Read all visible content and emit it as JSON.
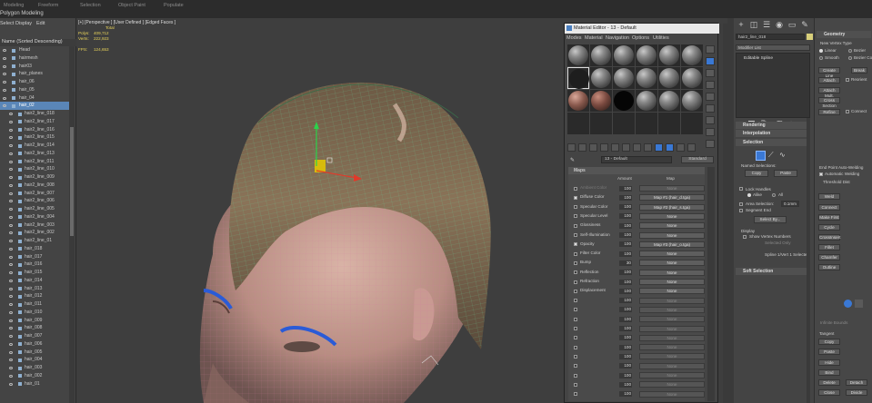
{
  "ribbon": {
    "tabs": [
      "Modeling",
      "Freeform",
      "Selection",
      "Object Paint",
      "Populate"
    ],
    "subtitle": "Polygon Modeling"
  },
  "explorer": {
    "menu": [
      "Select",
      "Display",
      "Edit"
    ],
    "header": "Name (Sorted Descending)",
    "rows": [
      {
        "label": "Head",
        "level": 0,
        "selected": false
      },
      {
        "label": "hairmesh",
        "level": 0,
        "selected": false
      },
      {
        "label": "hair03",
        "level": 0,
        "selected": false
      },
      {
        "label": "hair_planes",
        "level": 0,
        "selected": false
      },
      {
        "label": "hair_06",
        "level": 0,
        "selected": false
      },
      {
        "label": "hair_05",
        "level": 0,
        "selected": false
      },
      {
        "label": "hair_04",
        "level": 0,
        "selected": false
      },
      {
        "label": "hair_02",
        "level": 0,
        "selected": true
      },
      {
        "label": "hair2_line_018",
        "level": 1,
        "selected": false
      },
      {
        "label": "hair2_line_017",
        "level": 1,
        "selected": false
      },
      {
        "label": "hair2_line_016",
        "level": 1,
        "selected": false
      },
      {
        "label": "hair2_line_015",
        "level": 1,
        "selected": false
      },
      {
        "label": "hair2_line_014",
        "level": 1,
        "selected": false
      },
      {
        "label": "hair2_line_013",
        "level": 1,
        "selected": false
      },
      {
        "label": "hair2_line_011",
        "level": 1,
        "selected": false
      },
      {
        "label": "hair2_line_010",
        "level": 1,
        "selected": false
      },
      {
        "label": "hair2_line_009",
        "level": 1,
        "selected": false
      },
      {
        "label": "hair2_line_008",
        "level": 1,
        "selected": false
      },
      {
        "label": "hair2_line_007",
        "level": 1,
        "selected": false
      },
      {
        "label": "hair2_line_006",
        "level": 1,
        "selected": false
      },
      {
        "label": "hair2_line_005",
        "level": 1,
        "selected": false
      },
      {
        "label": "hair2_line_004",
        "level": 1,
        "selected": false
      },
      {
        "label": "hair2_line_003",
        "level": 1,
        "selected": false
      },
      {
        "label": "hair2_line_002",
        "level": 1,
        "selected": false
      },
      {
        "label": "hair2_line_01",
        "level": 1,
        "selected": false
      },
      {
        "label": "hair_018",
        "level": 1,
        "selected": false
      },
      {
        "label": "hair_017",
        "level": 1,
        "selected": false
      },
      {
        "label": "hair_016",
        "level": 1,
        "selected": false
      },
      {
        "label": "hair_015",
        "level": 1,
        "selected": false
      },
      {
        "label": "hair_014",
        "level": 1,
        "selected": false
      },
      {
        "label": "hair_013",
        "level": 1,
        "selected": false
      },
      {
        "label": "hair_012",
        "level": 1,
        "selected": false
      },
      {
        "label": "hair_011",
        "level": 1,
        "selected": false
      },
      {
        "label": "hair_010",
        "level": 1,
        "selected": false
      },
      {
        "label": "hair_009",
        "level": 1,
        "selected": false
      },
      {
        "label": "hair_008",
        "level": 1,
        "selected": false
      },
      {
        "label": "hair_007",
        "level": 1,
        "selected": false
      },
      {
        "label": "hair_006",
        "level": 1,
        "selected": false
      },
      {
        "label": "hair_005",
        "level": 1,
        "selected": false
      },
      {
        "label": "hair_004",
        "level": 1,
        "selected": false
      },
      {
        "label": "hair_003",
        "level": 1,
        "selected": false
      },
      {
        "label": "hair_002",
        "level": 1,
        "selected": false
      },
      {
        "label": "hair_01",
        "level": 1,
        "selected": false
      }
    ]
  },
  "viewport": {
    "label": "[+] [Perspective ] [User Defined ] [Edged Faces ]",
    "stats": {
      "total_label": "Total",
      "polys_label": "Polys:",
      "polys_value": "409,712",
      "verts_label": "Verts:",
      "verts_value": "222,923",
      "fps_label": "FPS:",
      "fps_value": "124,653"
    }
  },
  "material_editor": {
    "title": "Material Editor - 13 - Default",
    "menu": [
      "Modes",
      "Material",
      "Navigation",
      "Options",
      "Utilities"
    ],
    "material_name": "13 - Default",
    "material_type": "Standard",
    "maps_title": "Maps",
    "col_amount": "Amount",
    "col_map": "Map",
    "maps": [
      {
        "name": "Ambient Color",
        "amount": "100",
        "map": "None",
        "checked": false,
        "dim": true
      },
      {
        "name": "Diffuse Color",
        "amount": "100",
        "map": "Map #1 (hair_d.tga)",
        "checked": true,
        "dim": false
      },
      {
        "name": "Specular Color",
        "amount": "100",
        "map": "Map #2 (hair_s.tga)",
        "checked": false,
        "dim": false
      },
      {
        "name": "Specular Level",
        "amount": "100",
        "map": "None",
        "checked": false,
        "dim": false
      },
      {
        "name": "Glossiness",
        "amount": "100",
        "map": "None",
        "checked": false,
        "dim": false
      },
      {
        "name": "Self-Illumination",
        "amount": "100",
        "map": "None",
        "checked": false,
        "dim": false
      },
      {
        "name": "Opacity",
        "amount": "100",
        "map": "Map #3 (hair_o.tga)",
        "checked": true,
        "dim": false
      },
      {
        "name": "Filter Color",
        "amount": "100",
        "map": "None",
        "checked": false,
        "dim": false
      },
      {
        "name": "Bump",
        "amount": "30",
        "map": "None",
        "checked": false,
        "dim": false
      },
      {
        "name": "Reflection",
        "amount": "100",
        "map": "None",
        "checked": false,
        "dim": false
      },
      {
        "name": "Refraction",
        "amount": "100",
        "map": "None",
        "checked": false,
        "dim": false
      },
      {
        "name": "Displacement",
        "amount": "100",
        "map": "None",
        "checked": false,
        "dim": false
      },
      {
        "name": "",
        "amount": "100",
        "map": "None",
        "checked": false,
        "dim": true
      },
      {
        "name": "",
        "amount": "100",
        "map": "None",
        "checked": false,
        "dim": true
      },
      {
        "name": "",
        "amount": "100",
        "map": "None",
        "checked": false,
        "dim": true
      },
      {
        "name": "",
        "amount": "100",
        "map": "None",
        "checked": false,
        "dim": true
      },
      {
        "name": "",
        "amount": "100",
        "map": "None",
        "checked": false,
        "dim": true
      },
      {
        "name": "",
        "amount": "100",
        "map": "None",
        "checked": false,
        "dim": true
      },
      {
        "name": "",
        "amount": "100",
        "map": "None",
        "checked": false,
        "dim": true
      },
      {
        "name": "",
        "amount": "100",
        "map": "None",
        "checked": false,
        "dim": true
      },
      {
        "name": "",
        "amount": "100",
        "map": "None",
        "checked": false,
        "dim": true
      },
      {
        "name": "",
        "amount": "100",
        "map": "None",
        "checked": false,
        "dim": true
      },
      {
        "name": "",
        "amount": "100",
        "map": "None",
        "checked": false,
        "dim": true
      }
    ]
  },
  "command_panel": {
    "object_name": "hair2_line_018",
    "modifier_list": "Modifier List",
    "stack_item": "Editable Spline",
    "rollouts": {
      "rendering": "Rendering",
      "interpolation": "Interpolation",
      "selection": "Selection",
      "soft_selection": "Soft Selection",
      "geometry": "Geometry"
    },
    "selection": {
      "named_selections": "Named Selections:",
      "copy": "Copy",
      "paste": "Paste",
      "lock_handles": "Lock Handles",
      "alike": "Alike",
      "all": "All",
      "area_selection": "Area Selection:",
      "area_value": "0.1mm",
      "segment_end": "Segment End",
      "select_by": "Select By...",
      "display": "Display",
      "show_vertex_numbers": "Show Vertex Numbers",
      "selected_only": "Selected Only",
      "status": "Spline 1/Vert 1 Selected"
    },
    "geometry": {
      "new_vertex_type": "New Vertex Type",
      "linear": "Linear",
      "bezier": "Bezier",
      "smooth": "Smooth",
      "bezier_corner": "Bezier Corner",
      "create_line": "Create Line",
      "break": "Break",
      "attach": "Attach",
      "reorient": "Reorient",
      "attach_mult": "Attach Mult.",
      "cross_section": "Cross Section",
      "refine": "Refine",
      "connect": "Connect",
      "end_point_auto_welding": "End Point Auto-Welding",
      "automatic_welding": "Automatic Welding",
      "threshold_dist": "Threshold Dist",
      "weld": "Weld",
      "connect2": "Connect",
      "make_first": "Make First",
      "cycle": "Cycle",
      "crossinsert": "CrossInsert",
      "fillet": "Fillet",
      "chamfer": "Chamfer",
      "outline": "Outline",
      "tangent": "Tangent",
      "copy": "Copy",
      "paste": "Paste",
      "hide": "Hide",
      "bind": "Bind",
      "delete": "Delete",
      "close": "Close",
      "divide": "Divide",
      "detach": "Detach",
      "infinite_bounds": "Infinite Bounds"
    }
  }
}
